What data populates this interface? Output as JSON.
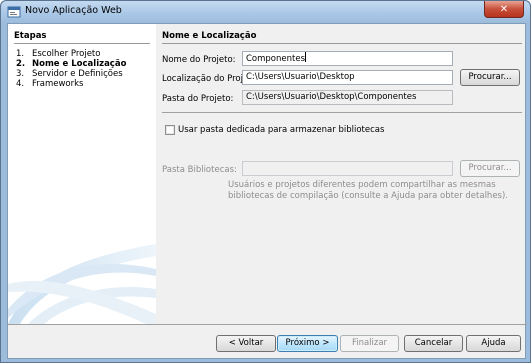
{
  "window": {
    "title": "Novo Aplicação Web",
    "close_glyph": "✕"
  },
  "steps_panel": {
    "heading": "Etapas",
    "items": [
      {
        "number": "1.",
        "label": "Escolher Projeto"
      },
      {
        "number": "2.",
        "label": "Nome e Localização",
        "current": true
      },
      {
        "number": "3.",
        "label": "Servidor e Definições"
      },
      {
        "number": "4.",
        "label": "Frameworks"
      }
    ]
  },
  "main": {
    "heading": "Nome e Localização",
    "project_name_label": "Nome do Projeto:",
    "project_name_value": "Componentes",
    "project_location_label": "Localização do Projeto:",
    "project_location_value": "C:\\Users\\Usuario\\Desktop",
    "browse_label": "Procurar...",
    "project_folder_label": "Pasta do Projeto:",
    "project_folder_value": "C:\\Users\\Usuario\\Desktop\\Componentes",
    "dedicated_folder_checkbox_label": "Usar pasta dedicada para armazenar bibliotecas",
    "dedicated_folder_checked": false,
    "libraries_folder_label": "Pasta Bibliotecas:",
    "libraries_folder_value": "",
    "libraries_browse_label": "Procurar...",
    "help_line_1": "Usuários e projetos diferentes podem compartilhar as mesmas",
    "help_line_2": "bibliotecas de compilação (consulte a Ajuda para obter detalhes)."
  },
  "footer": {
    "back_label": "< Voltar",
    "next_label": "Próximo >",
    "finish_label": "Finalizar",
    "cancel_label": "Cancelar",
    "help_label": "Ajuda"
  },
  "colors": {
    "title_bar": "#a8c6e6",
    "close_button": "#c7503a",
    "default_button_border": "#3c7fb1",
    "disabled_text": "#8d8d8d"
  },
  "icons": {
    "app": "app-window-icon",
    "close": "close-icon",
    "decoration": "swoosh-graphic"
  }
}
